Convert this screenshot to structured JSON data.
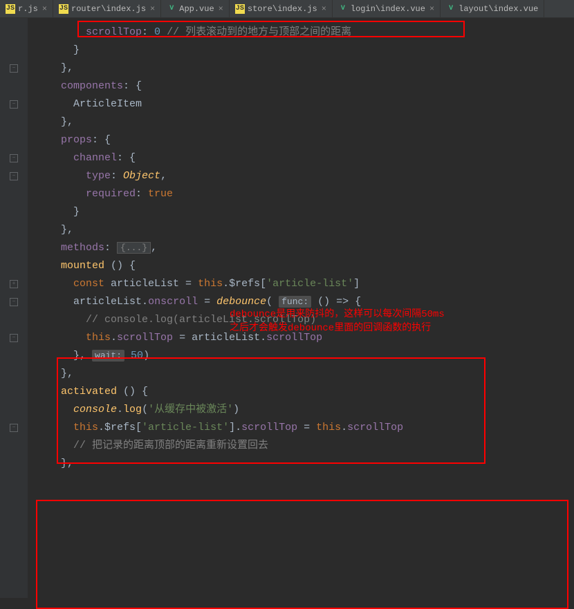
{
  "tabs": [
    {
      "icon": "js",
      "label": "r.js"
    },
    {
      "icon": "js",
      "label": "router\\index.js"
    },
    {
      "icon": "vue",
      "label": "App.vue"
    },
    {
      "icon": "js",
      "label": "store\\index.js"
    },
    {
      "icon": "vue",
      "label": "login\\index.vue"
    },
    {
      "icon": "vue",
      "label": "layout\\index.vue"
    }
  ],
  "code": {
    "l0_prop": "scrollTop",
    "l0_colon": ": ",
    "l0_val": "0",
    "l0_comment": " // 列表滚动到的地方与顶部之间的距离",
    "l1": "    }",
    "l2": "  },",
    "l3_prop": "components",
    "l3_rest": ": {",
    "l4": "    ArticleItem",
    "l5": "  },",
    "l6_prop": "props",
    "l6_rest": ": {",
    "l7_prop": "channel",
    "l7_rest": ": {",
    "l8_prop": "type",
    "l8_colon": ": ",
    "l8_val": "Object",
    "l8_comma": ",",
    "l9_prop": "required",
    "l9_colon": ": ",
    "l9_val": "true",
    "l10": "    }",
    "l11": "  },",
    "l12_prop": "methods",
    "l12_colon": ": ",
    "l12_fold": "{...}",
    "l12_comma": ",",
    "l13_fn": "mounted",
    "l13_rest": " () {",
    "l14_kw": "const",
    "l14_var": " articleList = ",
    "l14_this": "this",
    "l14_rest": ".$refs[",
    "l14_str": "'article-list'",
    "l14_end": "]",
    "l15_var": "articleList",
    "l15_dot": ".",
    "l15_prop": "onscroll",
    "l15_eq": " = ",
    "l15_fn": "debounce",
    "l15_open": "( ",
    "l15_hint": "func:",
    "l15_arrow": " () => {",
    "l16_comment": "// console.log(articleList.scrollTop)",
    "l17_this": "this",
    "l17_dot": ".",
    "l17_prop": "scrollTop",
    "l17_eq": " = articleList.",
    "l17_prop2": "scrollTop",
    "l18_close": "    }, ",
    "l18_hint": "wait:",
    "l18_sp": " ",
    "l18_num": "50",
    "l18_end": ")",
    "l19": "  },",
    "l20_fn": "activated",
    "l20_rest": " () {",
    "l21_obj": "console",
    "l21_dot": ".",
    "l21_fn": "log",
    "l21_open": "(",
    "l21_str": "'从缓存中被激活'",
    "l21_close": ")",
    "l22_this": "this",
    "l22_rest1": ".$refs[",
    "l22_str": "'article-list'",
    "l22_rest2": "].",
    "l22_prop": "scrollTop",
    "l22_eq": " = ",
    "l22_this2": "this",
    "l22_dot": ".",
    "l22_prop2": "scrollTop",
    "l23_comment": "// 把记录的距离顶部的距离重新设置回去",
    "l24": "  },"
  },
  "annotation": {
    "line1": "debounce是用来防抖的，这样可以每次间隔50ms",
    "line2": "之后才会触发debounce里面的回调函数的执行"
  }
}
